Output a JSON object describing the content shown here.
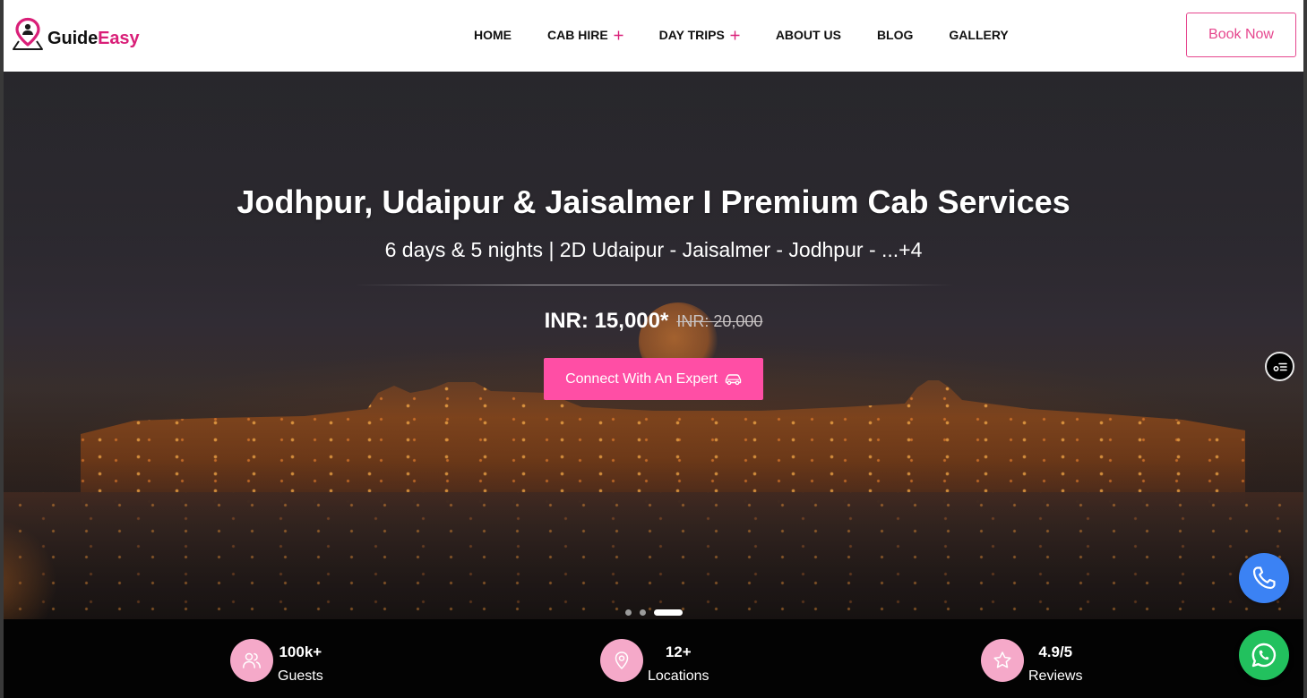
{
  "header": {
    "logo": {
      "part1": "Guide",
      "part2": "Easy",
      "icon": "location-pin-user-icon"
    },
    "nav": [
      {
        "label": "HOME",
        "submenu": false
      },
      {
        "label": "CAB HIRE",
        "submenu": true
      },
      {
        "label": "DAY TRIPS",
        "submenu": true
      },
      {
        "label": "ABOUT US",
        "submenu": false
      },
      {
        "label": "BLOG",
        "submenu": false
      },
      {
        "label": "GALLERY",
        "submenu": false
      }
    ],
    "book_button": "Book Now"
  },
  "hero": {
    "title": "Jodhpur, Udaipur & Jaisalmer I Premium Cab Services",
    "subtitle": "6 days & 5 nights | 2D Udaipur - Jaisalmer - Jodhpur - ...+4",
    "price": "INR: 15,000*",
    "old_price": "INR: 20,000",
    "cta": {
      "label": "Connect With An Expert",
      "icon": "car-icon"
    },
    "slider": {
      "count": 3,
      "active": 3
    }
  },
  "stats": [
    {
      "value": "100k+",
      "label": "Guests",
      "icon": "users-icon"
    },
    {
      "value": "12+",
      "label": "Locations",
      "icon": "location-pin-icon"
    },
    {
      "value": "4.9/5",
      "label": "Reviews",
      "icon": "star-icon"
    }
  ],
  "floating_buttons": {
    "side_menu_icon": "filter-list-icon",
    "call_icon": "phone-icon",
    "chat_icon": "whatsapp-icon"
  },
  "colors": {
    "brand_pink": "#d91f78",
    "book_pink": "#e6468e",
    "cta_pink": "#ff4ea5",
    "stat_icon_bg": "#f5a9c9",
    "call_blue": "#3b82f4",
    "whatsapp_green": "#22c15e"
  }
}
